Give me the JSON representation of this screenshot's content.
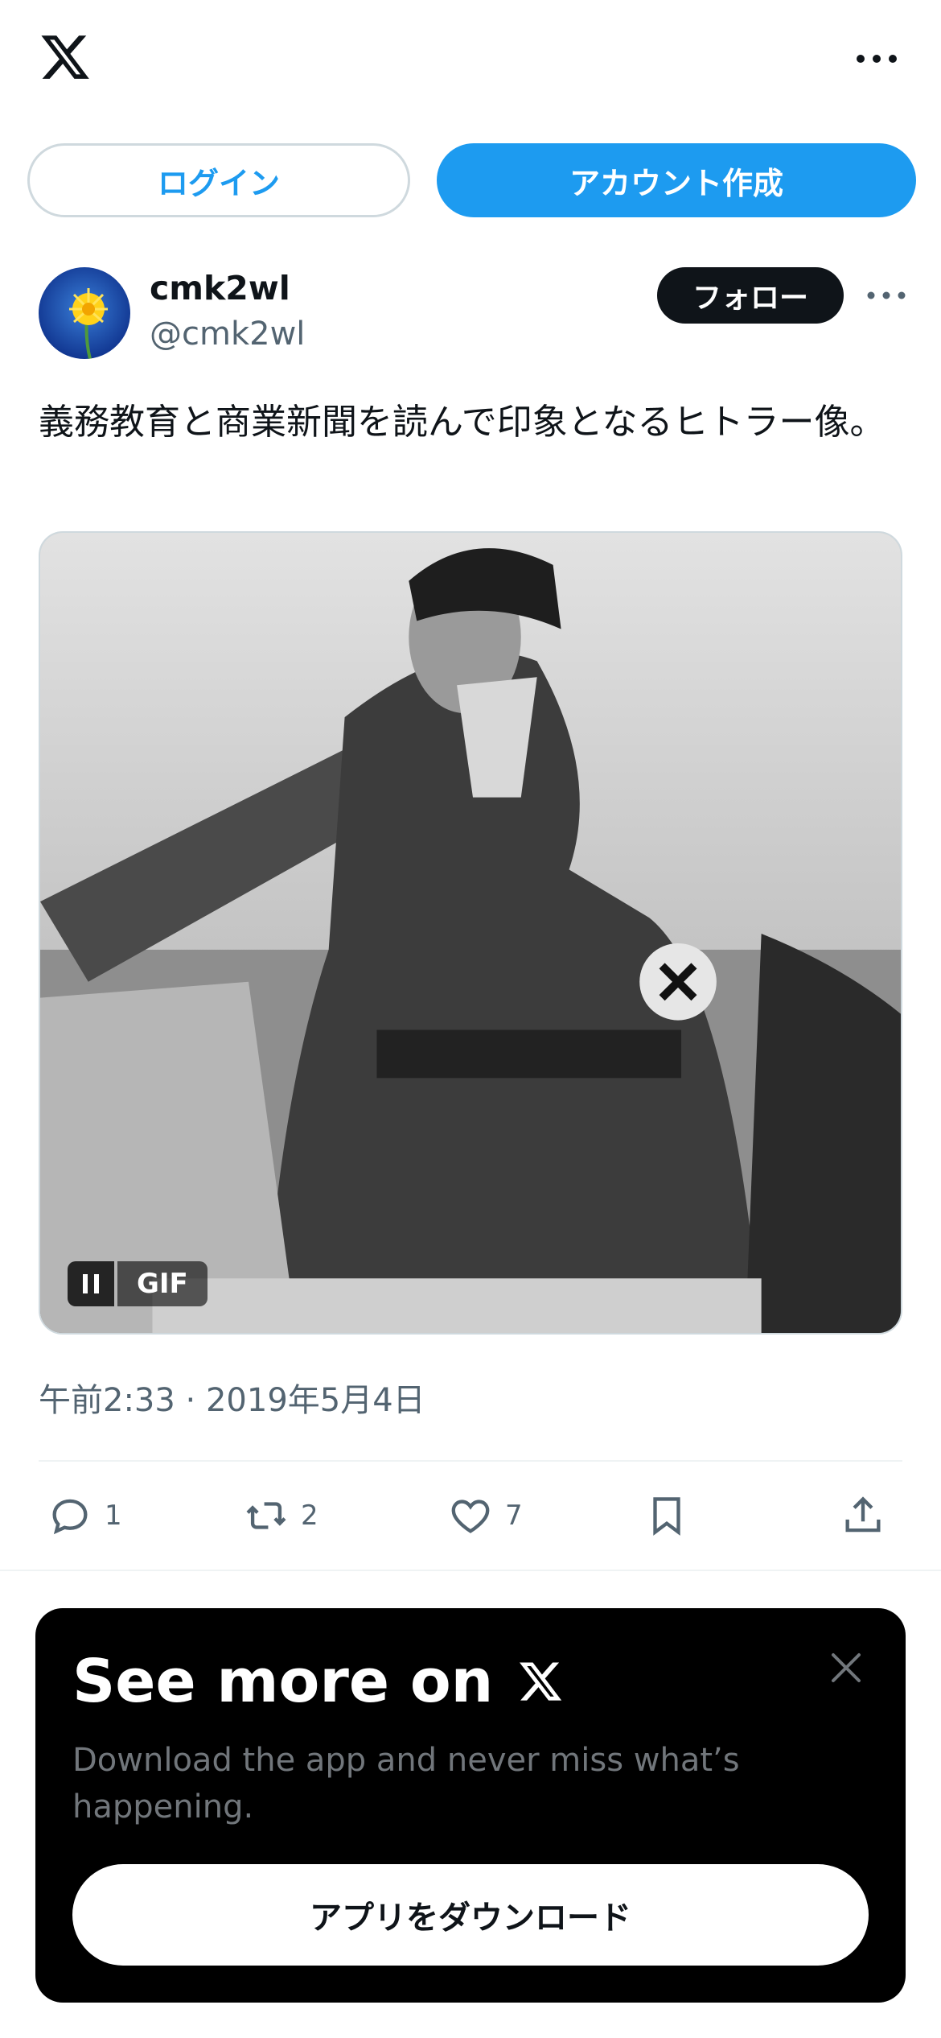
{
  "header": {
    "logo_icon": "x-logo-icon",
    "more_icon": "more-horizontal-icon"
  },
  "auth": {
    "login_label": "ログイン",
    "signup_label": "アカウント作成"
  },
  "post": {
    "author": {
      "display_name": "cmk2wl",
      "handle": "@cmk2wl",
      "avatar_icon": "dandelion-avatar"
    },
    "follow_label": "フォロー",
    "text": "義務教育と商業新聞を読んで印象となるヒトラー像。",
    "media": {
      "type": "GIF",
      "badge_label": "GIF",
      "control_icon": "pause-icon"
    },
    "timestamp": "午前2:33 · 2019年5月4日",
    "stats": {
      "replies": "1",
      "reposts": "2",
      "likes": "7"
    }
  },
  "promo": {
    "title": "See more on",
    "title_icon": "x-logo-icon",
    "subtitle": "Download the app and never miss what’s happening.",
    "cta_label": "アプリをダウンロード",
    "close_icon": "close-icon"
  },
  "colors": {
    "accent": "#1d9bf0",
    "text_primary": "#0f1419",
    "text_secondary": "#536471",
    "border": "#cfd9de",
    "promo_bg": "#000000"
  }
}
